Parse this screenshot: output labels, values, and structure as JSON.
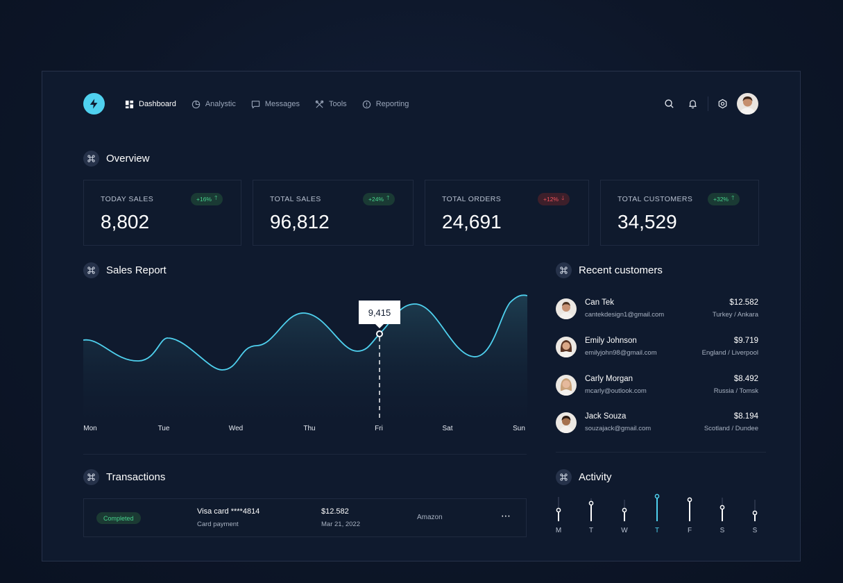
{
  "nav": {
    "items": [
      {
        "label": "Dashboard",
        "icon": "grid-icon",
        "active": true
      },
      {
        "label": "Analystic",
        "icon": "pie-chart-icon",
        "active": false
      },
      {
        "label": "Messages",
        "icon": "message-icon",
        "active": false
      },
      {
        "label": "Tools",
        "icon": "tools-icon",
        "active": false
      },
      {
        "label": "Reporting",
        "icon": "alert-circle-icon",
        "active": false
      }
    ]
  },
  "header_icons": [
    "search-icon",
    "bell-icon",
    "settings-icon"
  ],
  "overview": {
    "title": "Overview",
    "cards": [
      {
        "label": "TODAY SALES",
        "value": "8,802",
        "change": "+16%",
        "direction": "up"
      },
      {
        "label": "TOTAL SALES",
        "value": "96,812",
        "change": "+24%",
        "direction": "up"
      },
      {
        "label": "TOTAL ORDERS",
        "value": "24,691",
        "change": "+12%",
        "direction": "down"
      },
      {
        "label": "TOTAL CUSTOMERS",
        "value": "34,529",
        "change": "+32%",
        "direction": "up"
      }
    ]
  },
  "sales_report": {
    "title": "Sales Report",
    "tooltip": "9,415",
    "days": [
      "Mon",
      "Tue",
      "Wed",
      "Thu",
      "Fri",
      "Sat",
      "Sun"
    ]
  },
  "recent_customers": {
    "title": "Recent customers",
    "items": [
      {
        "name": "Can Tek",
        "email": "cantekdesign1@gmail.com",
        "amount": "$12.582",
        "location": "Turkey / Ankara"
      },
      {
        "name": "Emily Johnson",
        "email": "emilyjohn98@gmail.com",
        "amount": "$9.719",
        "location": "England / Liverpool"
      },
      {
        "name": "Carly Morgan",
        "email": "mcarly@outlook.com",
        "amount": "$8.492",
        "location": "Russia / Tomsk"
      },
      {
        "name": "Jack Souza",
        "email": "souzajack@gmail.com",
        "amount": "$8.194",
        "location": "Scotland / Dundee"
      }
    ]
  },
  "transactions": {
    "title": "Transactions",
    "rows": [
      {
        "status": "Completed",
        "method": "Visa card ****4814",
        "method_type": "Card payment",
        "amount": "$12.582",
        "date": "Mar 21, 2022",
        "merchant": "Amazon",
        "more": "⋯"
      }
    ]
  },
  "activity": {
    "title": "Activity",
    "days": [
      "M",
      "T",
      "W",
      "T",
      "F",
      "S",
      "S"
    ],
    "active_index": 3
  },
  "colors": {
    "accent": "#4fd1ef",
    "positive": "#47d38e",
    "negative": "#f0525c"
  }
}
